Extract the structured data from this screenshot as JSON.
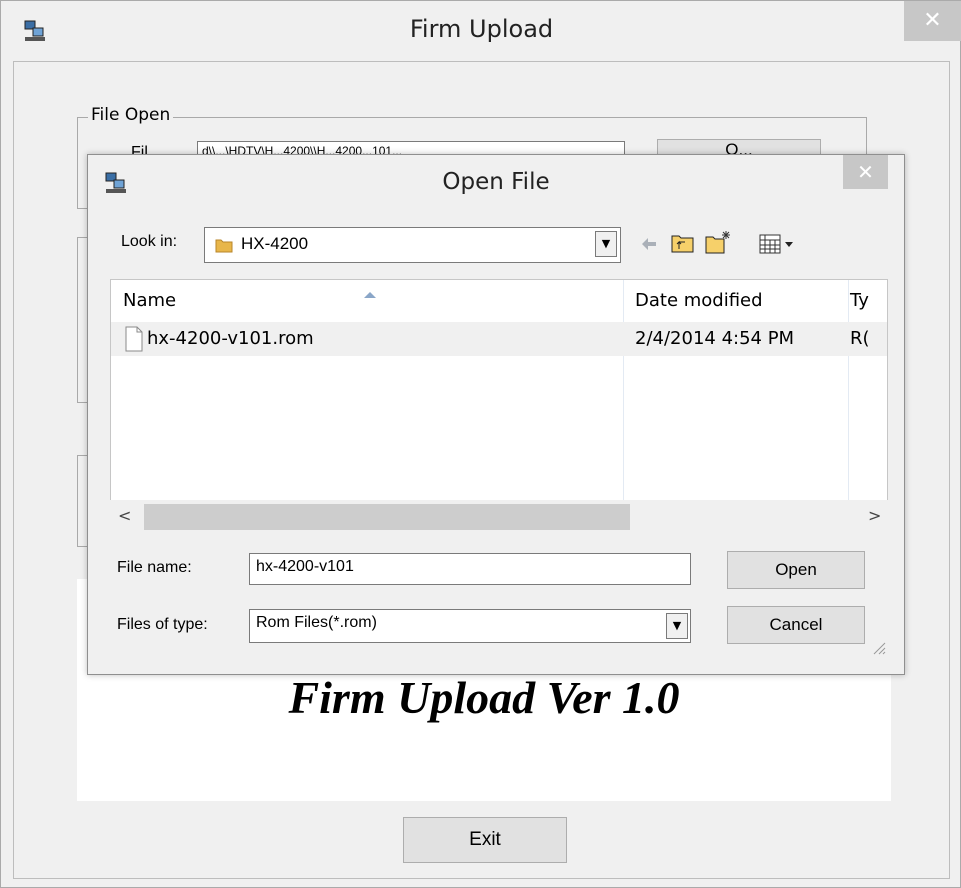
{
  "main": {
    "title": "Firm Upload",
    "close": "✕",
    "group_file_open": "File Open",
    "file_label_partial": "Fil",
    "file_path_partial": "d\\\\...\\HDTV\\H...4200\\\\H...4200...101...",
    "open_btn_partial": "O...",
    "banner": "Firm Upload Ver 1.0",
    "exit": "Exit"
  },
  "dialog": {
    "title": "Open File",
    "close": "✕",
    "look_in_label": "Look in:",
    "look_in_value": "HX-4200",
    "columns": [
      "Name",
      "Date modified",
      "Ty"
    ],
    "rows": [
      {
        "name": "hx-4200-v101.rom",
        "date": "2/4/2014 4:54 PM",
        "type": "R("
      }
    ],
    "file_name_label": "File name:",
    "file_name_value": "hx-4200-v101",
    "files_of_type_label": "Files of type:",
    "files_of_type_value": "Rom Files(*.rom)",
    "open_btn": "Open",
    "cancel_btn": "Cancel",
    "scroll_left": "<",
    "scroll_right": ">"
  },
  "colors": {
    "window_bg": "#f0f0f0",
    "close_bg": "#c7c7c7",
    "selected_row": "#f0f0f0",
    "folder": "#e8b64a"
  }
}
